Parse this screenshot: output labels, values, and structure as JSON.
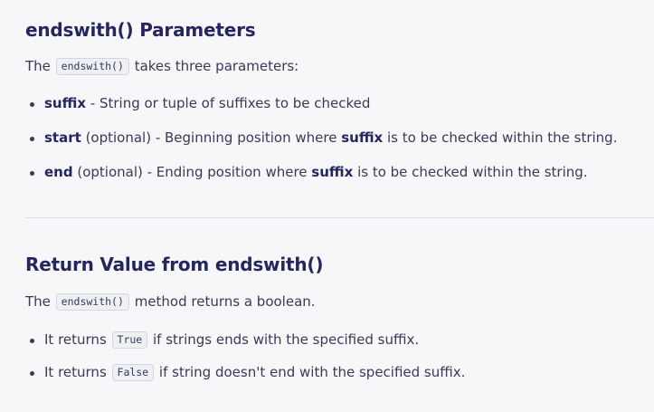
{
  "section1": {
    "heading": "endswith() Parameters",
    "intro_before": "The ",
    "intro_code": "endswith()",
    "intro_after": " takes three parameters:",
    "params": [
      {
        "name": "suffix",
        "text": " - String or tuple of suffixes to be checked"
      },
      {
        "name": "start",
        "text_before": " (optional) - Beginning position where ",
        "inline_bold": "suffix",
        "text_after": " is to be checked within the string."
      },
      {
        "name": "end",
        "text_before": " (optional) - Ending position where ",
        "inline_bold": "suffix",
        "text_after": " is to be checked within the string."
      }
    ]
  },
  "section2": {
    "heading": "Return Value from endswith()",
    "intro_before": "The ",
    "intro_code": "endswith()",
    "intro_after": " method returns a boolean.",
    "items": [
      {
        "before": "It returns ",
        "code": "True",
        "after": " if strings ends with the specified suffix."
      },
      {
        "before": "It returns ",
        "code": "False",
        "after": " if string doesn't end with the specified suffix."
      }
    ]
  },
  "colors": {
    "heading": "#25265e",
    "body_text": "#383a56",
    "background": "#f7f7f9",
    "code_background": "#eef0f4",
    "divider": "#dcdfe6"
  }
}
